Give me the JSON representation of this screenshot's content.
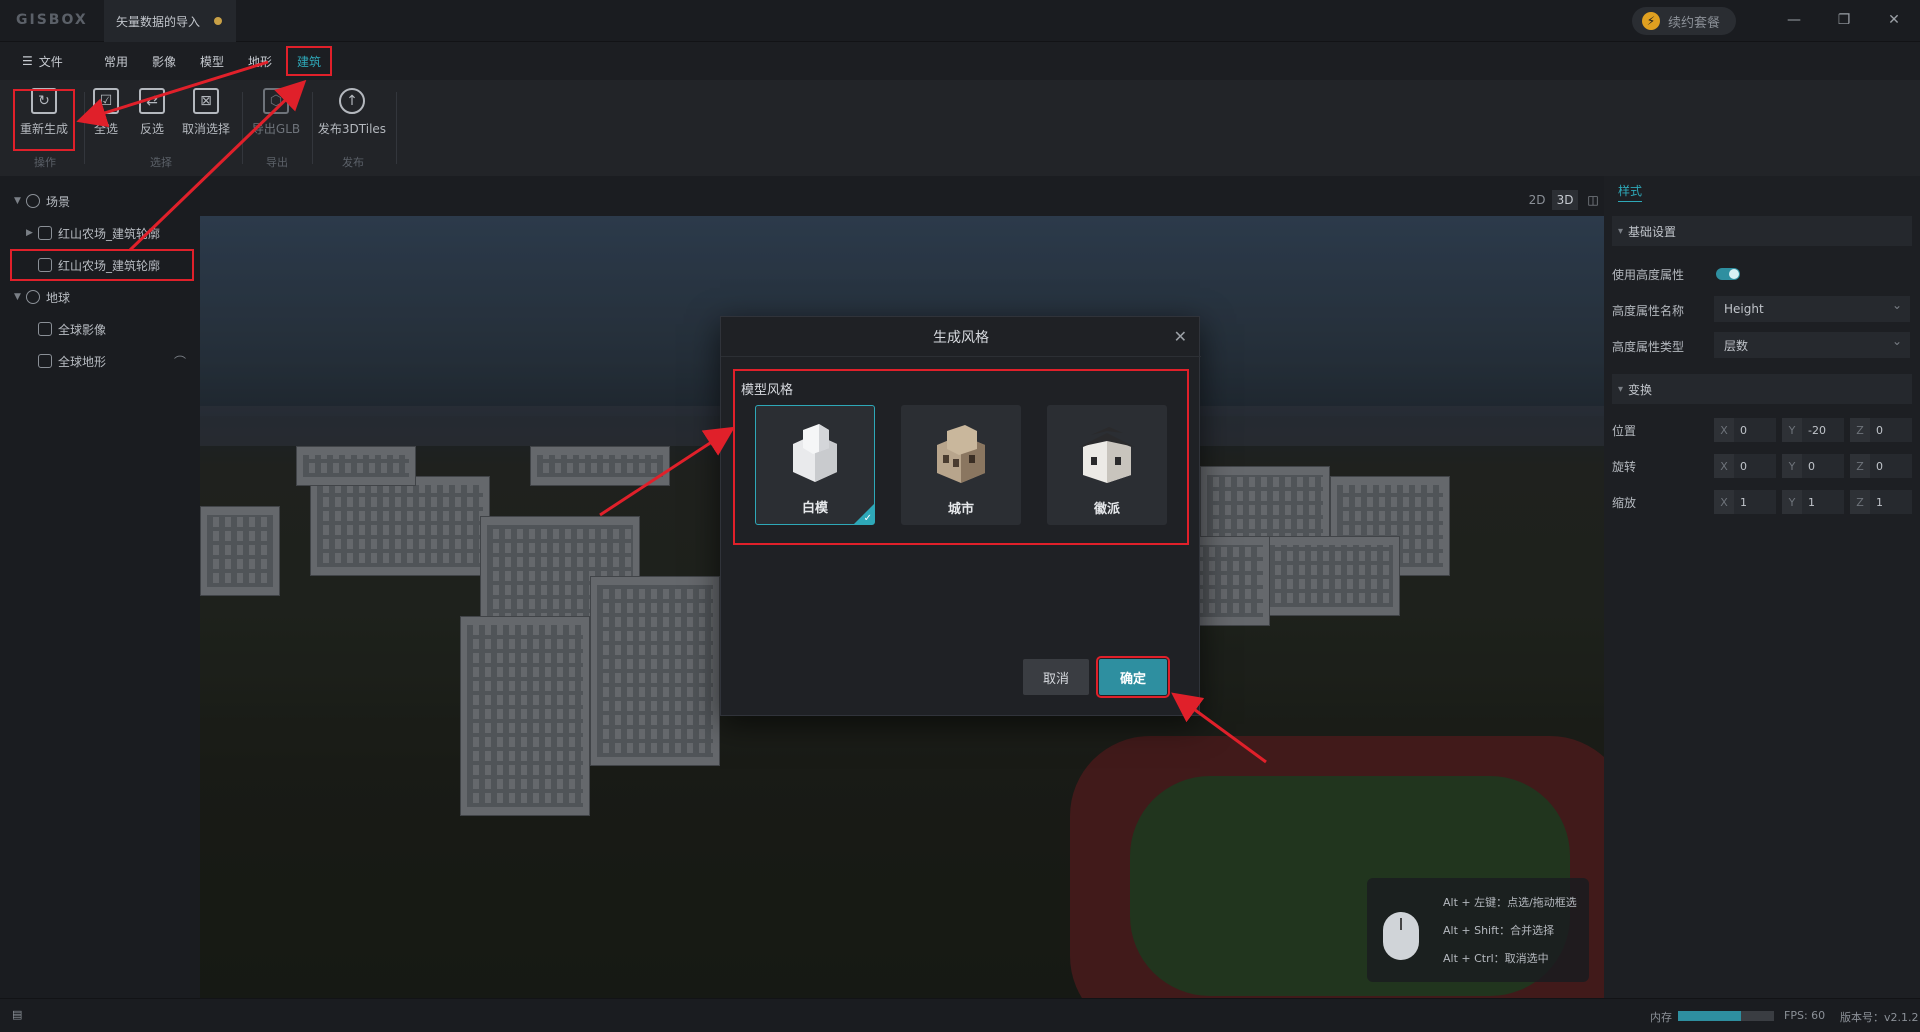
{
  "title_bar": {
    "logo": "GISBOX",
    "document_tab": "矢量数据的导入",
    "renew_label": "续约套餐",
    "renew_icon": "lightning-icon",
    "window_controls": [
      "minimize-icon",
      "restore-icon",
      "close-icon"
    ]
  },
  "menu": {
    "file_label": "文件",
    "items": [
      "常用",
      "影像",
      "模型",
      "地形",
      "建筑"
    ],
    "active": "建筑"
  },
  "ribbon": {
    "buttons": [
      {
        "label": "重新生成",
        "icon": "regenerate-icon",
        "enabled": true
      },
      {
        "label": "全选",
        "icon": "select-all-icon",
        "enabled": true
      },
      {
        "label": "反选",
        "icon": "invert-select-icon",
        "enabled": true
      },
      {
        "label": "取消选择",
        "icon": "deselect-icon",
        "enabled": true
      },
      {
        "label": "导出GLB",
        "icon": "export-glb-icon",
        "enabled": false
      },
      {
        "label": "发布3DTiles",
        "icon": "publish-cloud-icon",
        "enabled": true
      }
    ],
    "groups": [
      "操作",
      "选择",
      "导出",
      "发布"
    ]
  },
  "tree": {
    "scene_label": "场景",
    "scene_items": [
      {
        "label": "红山农场_建筑轮廓",
        "icon": "cube-icon"
      },
      {
        "label": "红山农场_建筑轮廓",
        "icon": "building-icon"
      }
    ],
    "earth_label": "地球",
    "earth_items": [
      {
        "label": "全球影像",
        "icon": "imagery-icon"
      },
      {
        "label": "全球地形",
        "icon": "terrain-icon"
      }
    ]
  },
  "view_modes": [
    "2D",
    "3D",
    "split"
  ],
  "view_mode_active": "3D",
  "right_panel": {
    "tab": "样式",
    "basic_section": "基础设置",
    "use_height_label": "使用高度属性",
    "use_height_on": true,
    "height_name_label": "高度属性名称",
    "height_name_value": "Height",
    "height_type_label": "高度属性类型",
    "height_type_value": "层数",
    "transform_section": "变换",
    "position_label": "位置",
    "position": {
      "x": "0",
      "y": "-20",
      "z": "0"
    },
    "rotation_label": "旋转",
    "rotation": {
      "x": "0",
      "y": "0",
      "z": "0"
    },
    "scale_label": "缩放",
    "scale": {
      "x": "1",
      "y": "1",
      "z": "1"
    },
    "axes": [
      "X",
      "Y",
      "Z"
    ]
  },
  "dialog": {
    "title": "生成风格",
    "section_label": "模型风格",
    "styles": [
      {
        "name": "白模",
        "selected": true
      },
      {
        "name": "城市",
        "selected": false
      },
      {
        "name": "徽派",
        "selected": false
      }
    ],
    "cancel_label": "取消",
    "ok_label": "确定"
  },
  "hint": {
    "lines": [
      "Alt + 左键：点选/拖动框选",
      "Alt + Shift：合并选择",
      "Alt + Ctrl：取消选中"
    ]
  },
  "status": {
    "memory_label": "内存",
    "memory_fraction": 0.66,
    "fps": "FPS: 60",
    "version": "版本号：v2.1.2"
  },
  "colors": {
    "accent": "#2ea8b8",
    "annotation": "#e0202a"
  }
}
